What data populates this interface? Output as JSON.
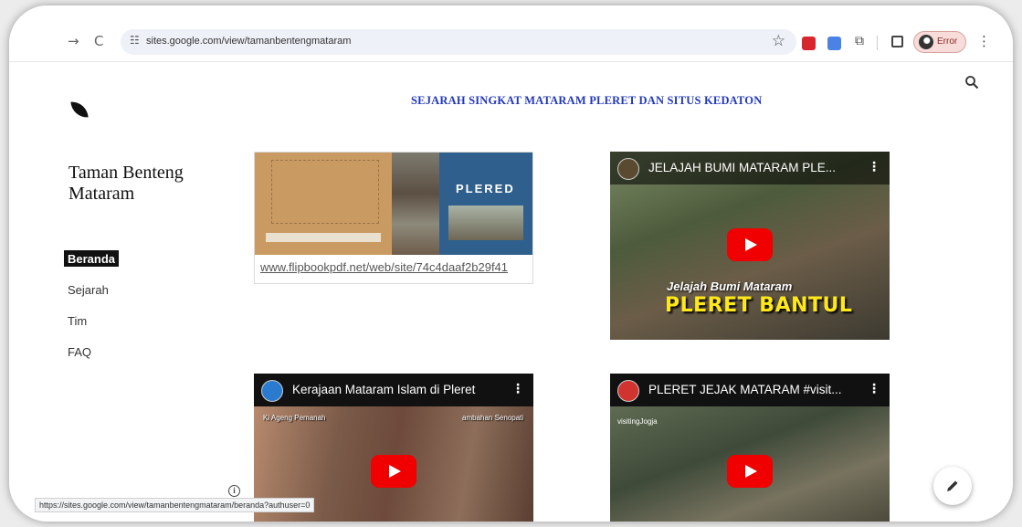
{
  "browser": {
    "back_glyph": "→",
    "reload_glyph": "C",
    "site_info_glyph": "☷",
    "url": "sites.google.com/view/tamanbentengmataram",
    "bookmark_glyph": "☆",
    "extension_puzzle_glyph": "⧉",
    "profile_label": "Error",
    "menu_glyph": "⋮"
  },
  "site": {
    "name": "Taman Benteng Mataram",
    "heading": "SEJARAH SINGKAT MATARAM PLERET DAN SITUS KEDATON"
  },
  "nav": {
    "items": [
      {
        "label": "Beranda",
        "active": true
      },
      {
        "label": "Sejarah",
        "active": false
      },
      {
        "label": "Tim",
        "active": false
      },
      {
        "label": "FAQ",
        "active": false
      }
    ]
  },
  "book": {
    "cover_title": "PLERED",
    "link_text": "www.flipbookpdf.net/web/site/74c4daaf2b29f41"
  },
  "videos": [
    {
      "title": "JELAJAH BUMI MATARAM PLE...",
      "overlay_sub": "Jelajah Bumi Mataram",
      "overlay_main": "PLERET BANTUL"
    },
    {
      "title": "Kerajaan Mataram Islam di Pleret",
      "overlay_left": "Ki Ageng Pemanah",
      "overlay_right": "ambahan Senopati"
    },
    {
      "title": "PLERET JEJAK MATARAM #visit...",
      "overlay_brand": "visitingJogja"
    }
  ],
  "video_menu_glyph": "⋮",
  "info_glyph": "i",
  "status_bar_url": "https://sites.google.com/view/tamanbentengmataram/beranda?authuser=0",
  "colors": {
    "heading": "#2238b8",
    "nav_active_bg": "#111111",
    "play_button": "#f00000",
    "overlay_yellow": "#ffe81a"
  }
}
